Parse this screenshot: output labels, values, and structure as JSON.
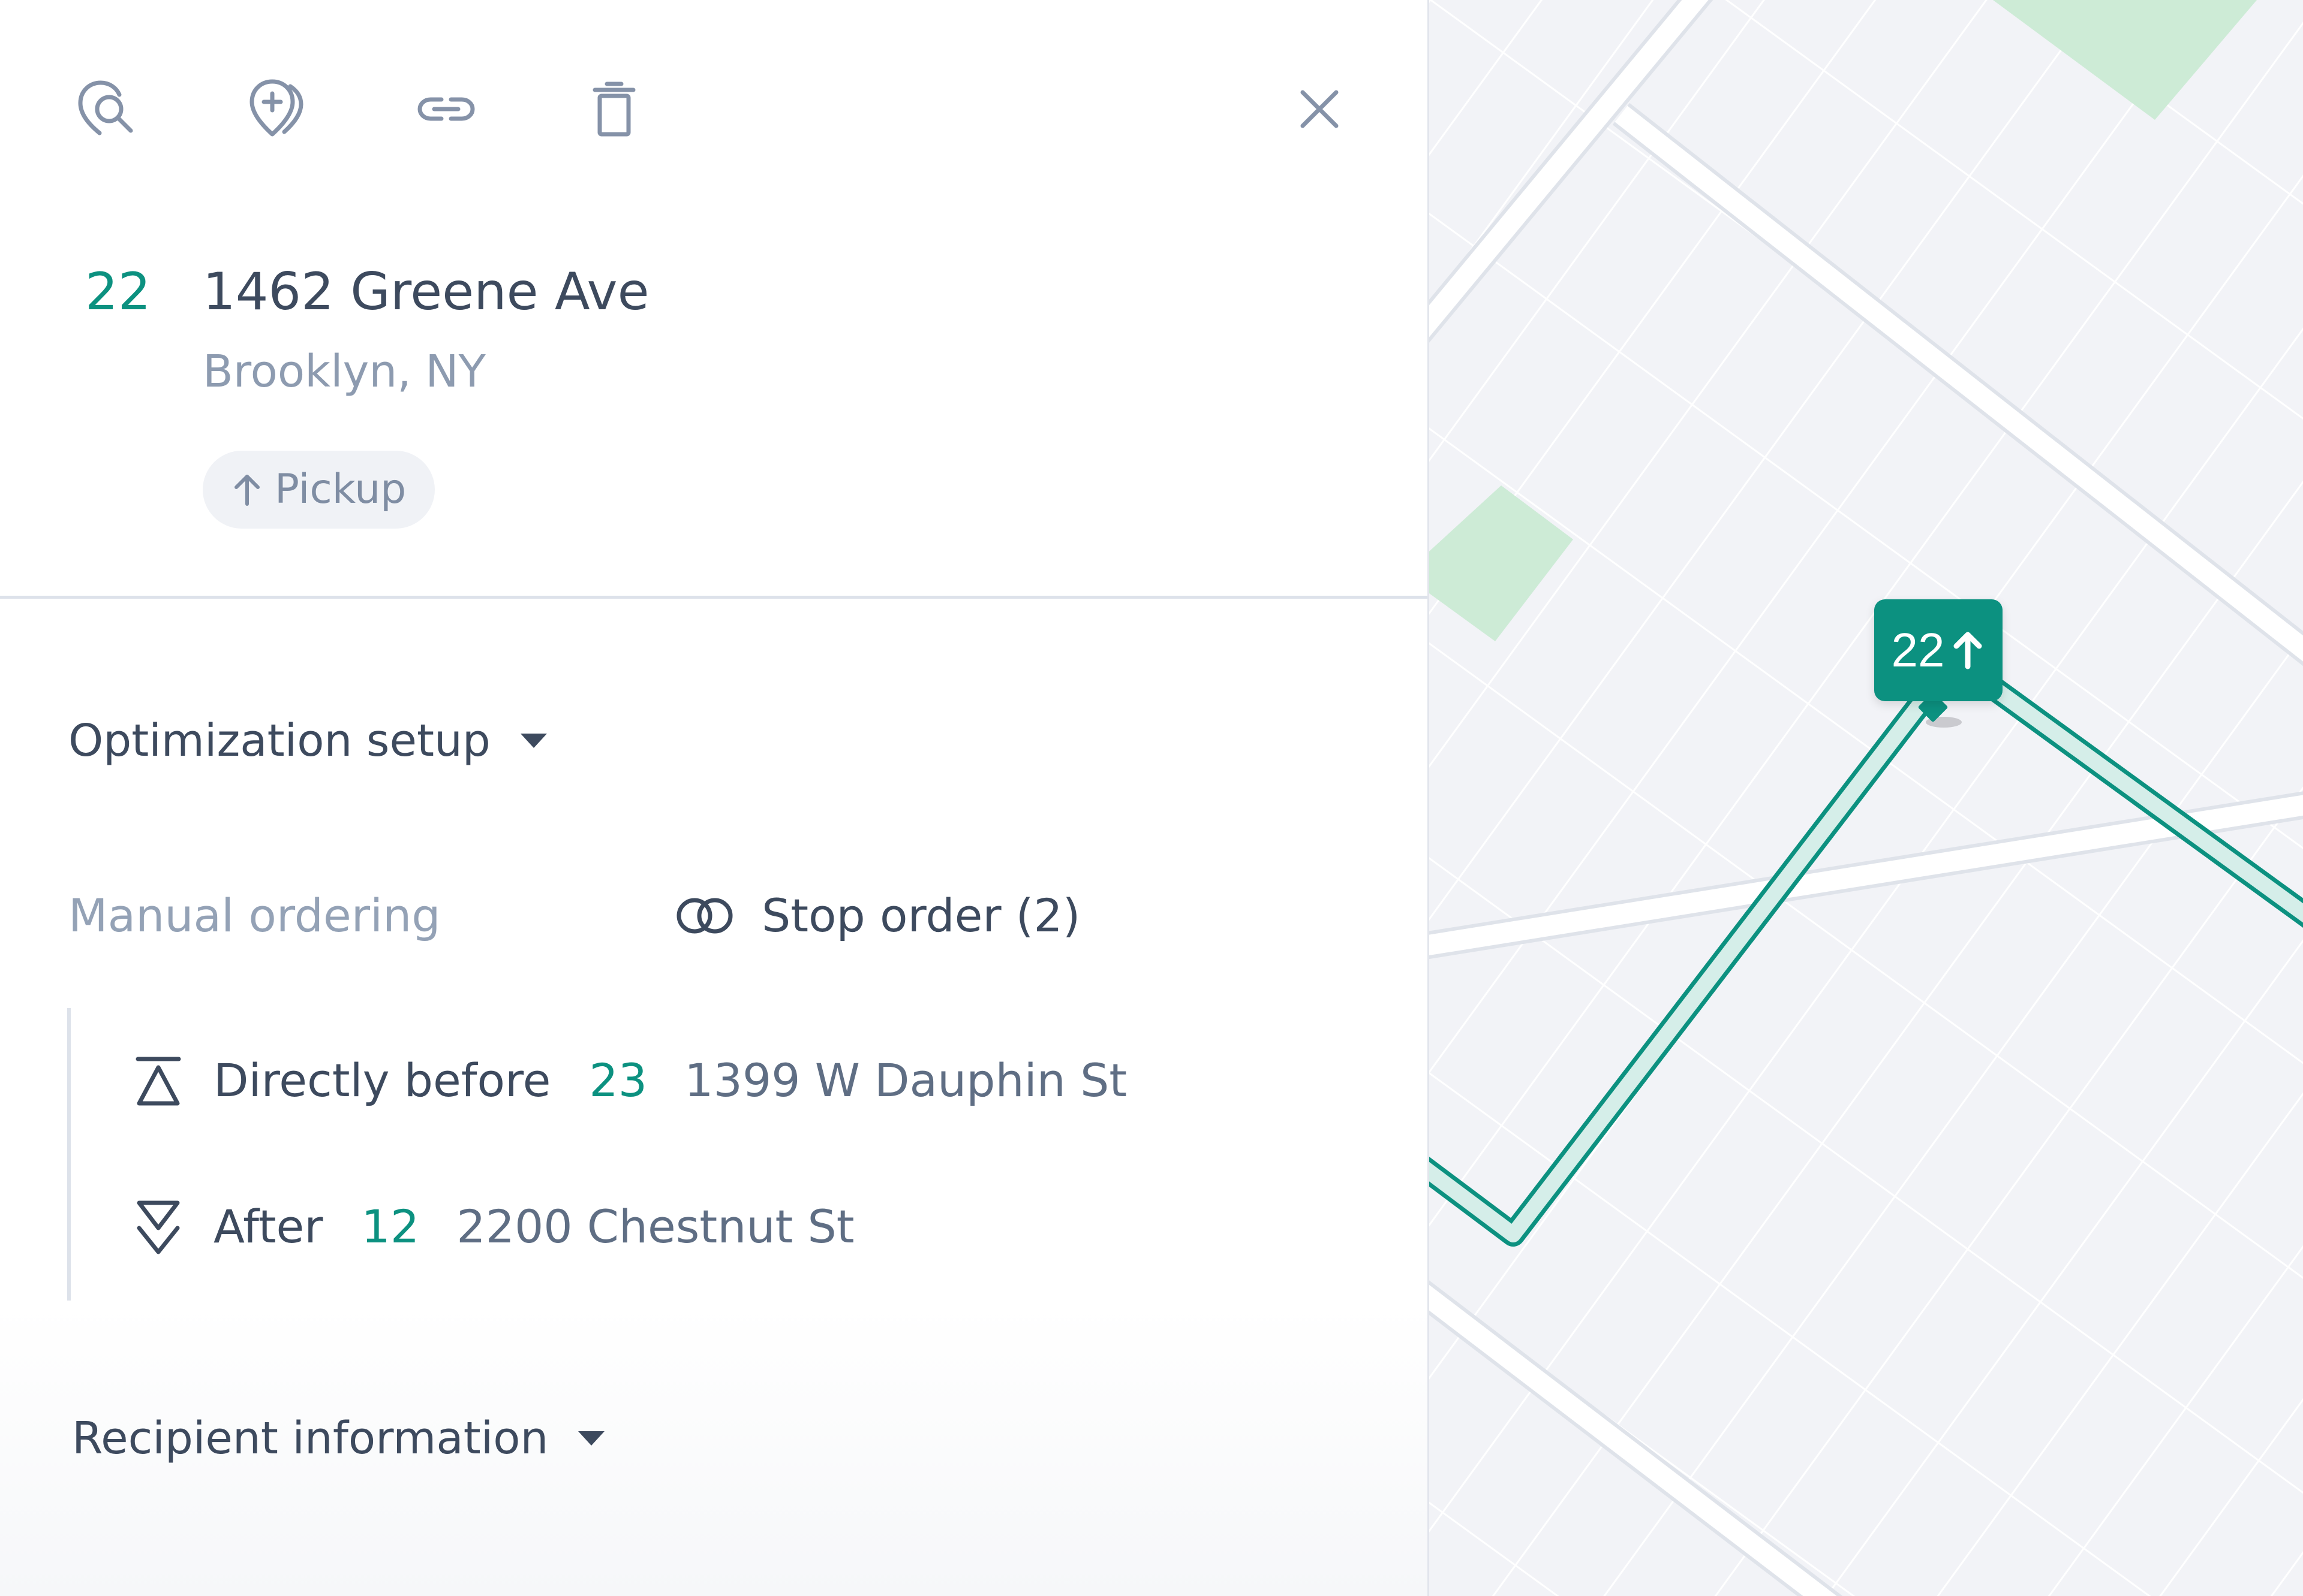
{
  "toolbar": {
    "icons": [
      "search-location-icon",
      "add-stop-icon",
      "link-icon",
      "trash-icon",
      "close-icon"
    ]
  },
  "stop": {
    "number": "22",
    "street": "1462 Greene Ave",
    "city": "Brooklyn, NY",
    "type_label": "Pickup",
    "type_icon": "arrow-up-icon"
  },
  "optimization": {
    "header": "Optimization setup",
    "manual_label": "Manual ordering",
    "stop_order_label": "Stop order (2)",
    "rules": [
      {
        "kind": "Directly before",
        "stop_number": "23",
        "address": "1399 W Dauphin St",
        "icon": "directly-before-icon"
      },
      {
        "kind": "After",
        "stop_number": "12",
        "address": "2200 Chestnut St",
        "icon": "after-icon"
      }
    ]
  },
  "recipient": {
    "header": "Recipient information"
  },
  "map": {
    "pin_label": "22",
    "pin_icon": "arrow-up-icon",
    "colors": {
      "accent": "#0c9180",
      "park": "#cdebd6",
      "road": "#ffffff",
      "block": "#f2f3f7"
    }
  }
}
